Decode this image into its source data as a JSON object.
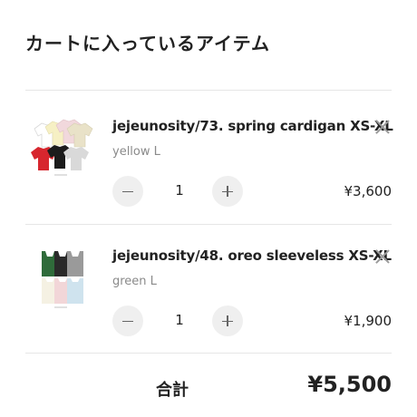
{
  "page": {
    "title": "カートに入っているアイテム"
  },
  "cart": {
    "items": [
      {
        "name": "jejeunosity/73. spring cardigan XS-XL",
        "variant": "yellow L",
        "quantity": "1",
        "price": "¥3,600",
        "image": "cardigan-thumbnail",
        "colors": [
          "#f6f0c4",
          "#f1d8dc",
          "#e9e2c8",
          "#ffffff",
          "#d7262e",
          "#1c1c1c",
          "#d9d9d9"
        ]
      },
      {
        "name": "jejeunosity/48. oreo sleeveless XS-XL",
        "variant": "green L",
        "quantity": "1",
        "price": "¥1,900",
        "image": "sleeveless-thumbnail",
        "colors": [
          "#2f6b3a",
          "#2a2a2a",
          "#9a9a9a",
          "#f5f1e3",
          "#f2d6d8",
          "#cfe3ee"
        ]
      }
    ]
  },
  "summary": {
    "total_label": "合計",
    "total_value": "¥5,500"
  }
}
